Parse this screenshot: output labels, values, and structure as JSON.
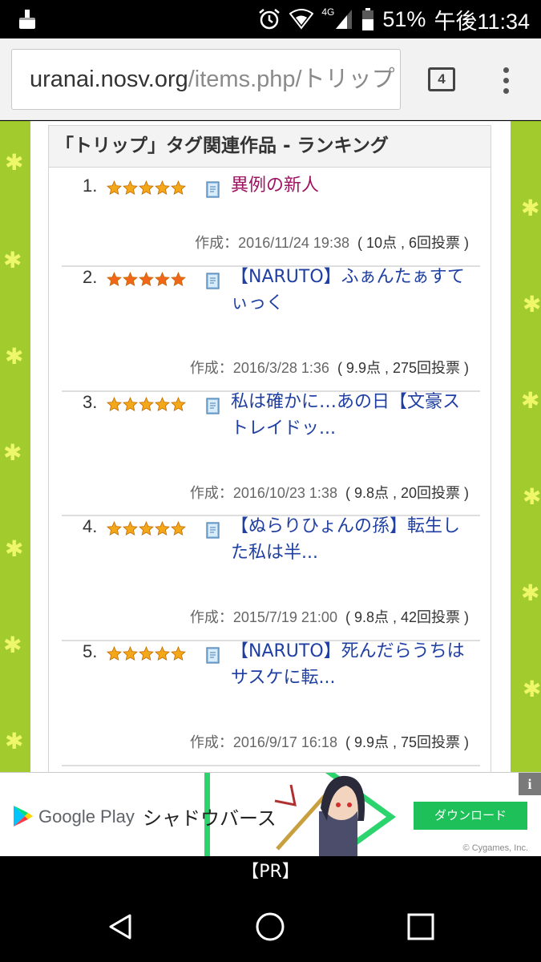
{
  "status_bar": {
    "network": "4G",
    "battery": "51%",
    "time": "午後11:34"
  },
  "browser": {
    "url_host": "uranai.nosv.org",
    "url_path": "/items.php/トリップ",
    "tab_count": "4"
  },
  "ranking": {
    "header": "「トリップ」タグ関連作品 - ランキング",
    "items": [
      {
        "rank": "1.",
        "title": "異例の新人",
        "visited": true,
        "star_color": "gold",
        "stars": 5,
        "created": "作成：2016/11/24 19:38",
        "score": "( 10点 , 6回投票 )"
      },
      {
        "rank": "2.",
        "title": "【NARUTO】ふぁんたぁすてぃっく",
        "visited": false,
        "star_color": "orange",
        "stars": 5,
        "created": "作成：2016/3/28 1:36",
        "score": "( 9.9点 , 275回投票 )"
      },
      {
        "rank": "3.",
        "title": "私は確かに…あの日【文豪ストレイドッ...",
        "visited": false,
        "star_color": "gold",
        "stars": 5,
        "created": "作成：2016/10/23 1:38",
        "score": "( 9.8点 , 20回投票 )"
      },
      {
        "rank": "4.",
        "title": "【ぬらりひょんの孫】転生した私は半...",
        "visited": false,
        "star_color": "gold",
        "stars": 5,
        "created": "作成：2015/7/19 21:00",
        "score": "( 9.8点 , 42回投票 )"
      },
      {
        "rank": "5.",
        "title": "【NARUTO】死んだらうちはサスケに転...",
        "visited": false,
        "star_color": "gold",
        "stars": 5,
        "created": "作成：2016/9/17 16:18",
        "score": "( 9.9点 , 75回投票 )"
      }
    ]
  },
  "ad": {
    "store": "Google Play",
    "title": "シャドウバース",
    "download": "ダウンロード",
    "info": "i",
    "copyright": "© Cygames, Inc."
  },
  "pr_label": "【PR】",
  "colors": {
    "page_bg": "#a2cb2e",
    "link": "#1f3fa3",
    "visited_link": "#9e1462",
    "star_gold": "#f3a81a",
    "star_orange": "#f2661c",
    "ad_green": "#1ec05a"
  },
  "icons": [
    "paint-brush-icon",
    "alarm-icon",
    "wifi-icon",
    "signal-icon",
    "battery-icon",
    "book-icon",
    "star-icon",
    "google-play-icon",
    "info-icon",
    "back-icon",
    "home-icon",
    "recents-icon",
    "overflow-menu-icon"
  ]
}
